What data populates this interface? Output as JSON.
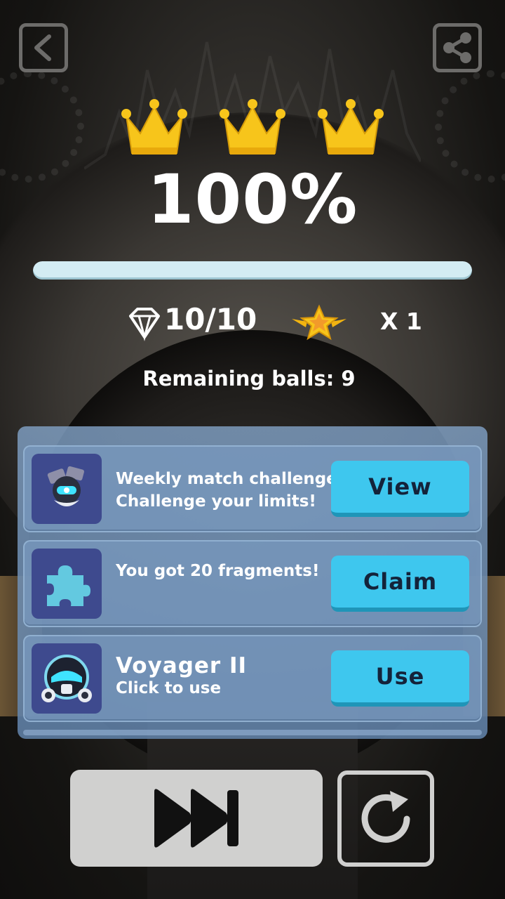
{
  "result": {
    "crowns_earned": 3,
    "percent": "100%",
    "progress": 1.0
  },
  "stats": {
    "gems": "10/10",
    "star_multiplier": "X 1",
    "remaining_balls": "Remaining balls: 9"
  },
  "rewards": [
    {
      "icon": "robot-character-icon",
      "line1": "Weekly match challenge",
      "line2": "Challenge your limits!",
      "button": "View"
    },
    {
      "icon": "puzzle-piece-icon",
      "line1": "You got 20 fragments!",
      "button": "Claim"
    },
    {
      "icon": "voyager-helmet-icon",
      "title": "Voyager II",
      "subtitle": "Click to use",
      "button": "Use"
    }
  ],
  "colors": {
    "crown": "#f7c51b",
    "accent_button": "#3ec7ee",
    "progress_fill": "#d3ecf3",
    "panel": "#809fc4"
  },
  "controls": {
    "back": "back-icon",
    "share": "share-icon",
    "skip": "fast-forward-icon",
    "replay": "replay-icon"
  }
}
